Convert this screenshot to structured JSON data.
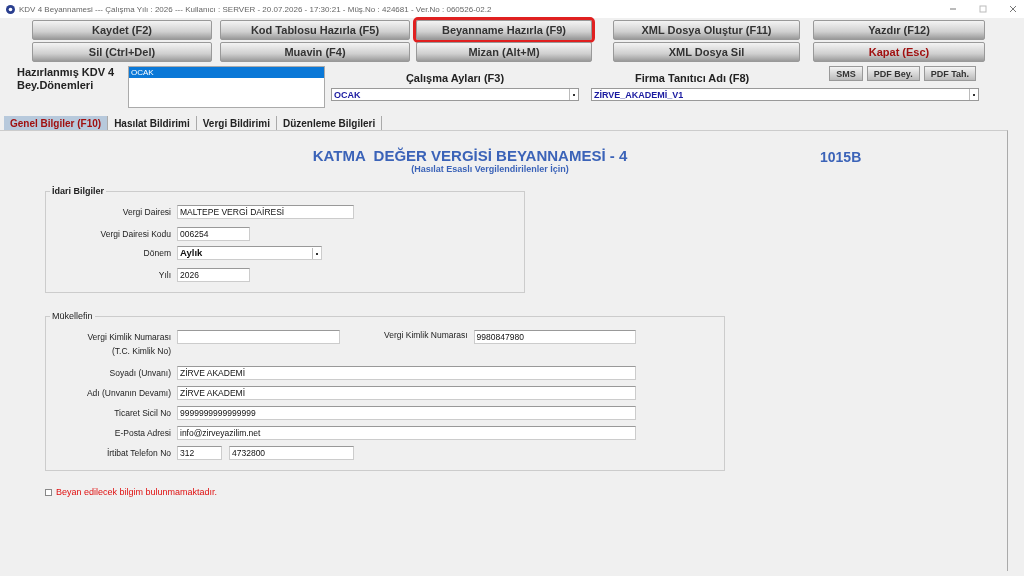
{
  "window": {
    "title": "KDV 4 Beyannamesi  ---  Çalışma Yılı : 2026  ---  Kullanıcı : SERVER - 20.07.2026 - 17:30:21 - Müş.No : 424681 - Ver.No : 060526-02.2"
  },
  "toolbar": {
    "rows": [
      [
        {
          "label": "Kaydet (F2)",
          "highlighted": false,
          "kind": "normal"
        },
        {
          "label": "Kod Tablosu Hazırla (F5)",
          "highlighted": false,
          "kind": "normal"
        },
        {
          "label": "Beyanname Hazırla (F9)",
          "highlighted": true,
          "kind": "normal"
        },
        {
          "label": "XML Dosya Oluştur (F11)",
          "highlighted": false,
          "kind": "normal"
        },
        {
          "label": "Yazdır (F12)",
          "highlighted": false,
          "kind": "normal"
        }
      ],
      [
        {
          "label": "Sil (Ctrl+Del)",
          "highlighted": false,
          "kind": "normal"
        },
        {
          "label": "Muavin (F4)",
          "highlighted": false,
          "kind": "normal"
        },
        {
          "label": "Mizan (Alt+M)",
          "highlighted": false,
          "kind": "normal"
        },
        {
          "label": "XML Dosya Sil",
          "highlighted": false,
          "kind": "normal"
        },
        {
          "label": "Kapat (Esc)",
          "highlighted": false,
          "kind": "danger"
        }
      ]
    ]
  },
  "periods": {
    "label": "Hazırlanmış KDV 4 Bey.Dönemleri",
    "items": [
      {
        "text": "OCAK",
        "selected": true
      }
    ]
  },
  "months": {
    "label": "Çalışma Ayları (F3)",
    "value": "OCAK"
  },
  "company": {
    "label": "Firma Tanıtıcı Adı (F8)",
    "value": "ZİRVE_AKADEMİ_V1"
  },
  "small_buttons": [
    "SMS",
    "PDF Bey.",
    "PDF Tah."
  ],
  "tabs": [
    {
      "label": "Genel Bilgiler (F10)",
      "selected": true
    },
    {
      "label": "Hasılat Bildirimi",
      "selected": false
    },
    {
      "label": "Vergi Bildirimi",
      "selected": false
    },
    {
      "label": "Düzenleme Bilgileri",
      "selected": false
    }
  ],
  "form": {
    "title": "KATMA  DEĞER VERGİSİ BEYANNAMESİ - 4",
    "subtitle": "(Hasılat Esaslı Vergilendirilenler İçin)",
    "code": "1015B"
  },
  "idari": {
    "legend": "İdari Bilgiler",
    "fields": [
      {
        "label": "Vergi Dairesi",
        "value": "MALTEPE VERGİ DAİRESİ",
        "kind": "long"
      },
      {
        "label": "Vergi Dairesi Kodu",
        "value": "006254",
        "kind": "short"
      },
      {
        "label": "Dönem",
        "value": "Aylık",
        "kind": "select"
      },
      {
        "label": "Yılı",
        "value": "2026",
        "kind": "short"
      }
    ]
  },
  "mukellef": {
    "legend": "Mükellefin",
    "tc": {
      "label": "Vergi Kimlik Numarası",
      "sublabel": "(T.C. Kimlik No)"
    },
    "vkn": {
      "label": "Vergi Kimlik Numarası",
      "value": "9980847980"
    },
    "fields": [
      {
        "label": "Soyadı (Unvanı)",
        "value": "ZİRVE AKADEMİ"
      },
      {
        "label": "Adı (Unvanın Devamı)",
        "value": "ZİRVE AKADEMİ"
      },
      {
        "label": "Ticaret Sicil No",
        "value": "9999999999999999"
      },
      {
        "label": "E-Posta Adresi",
        "value": "info@zirveyazilim.net"
      }
    ],
    "phone": {
      "label": "İrtibat Telefon No",
      "area": "312",
      "number": "4732800"
    }
  },
  "checkbox": {
    "label": "Beyan edilecek bilgim bulunmamaktadır.",
    "checked": false
  }
}
